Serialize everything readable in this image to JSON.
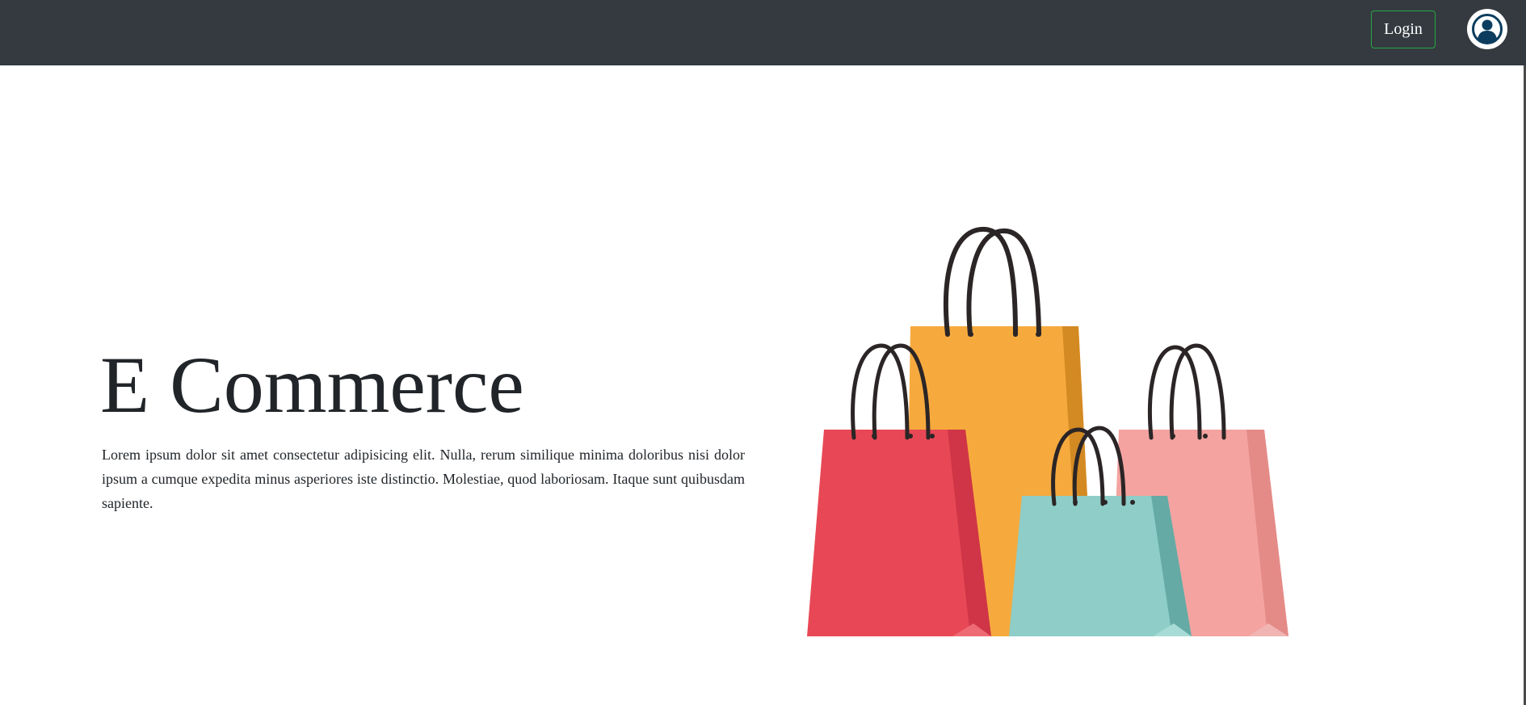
{
  "navbar": {
    "login_label": "Login",
    "avatar_icon": "user-avatar-icon",
    "background": "#343a40",
    "login_border": "#28a745"
  },
  "hero": {
    "title": "E Commerce",
    "description": "Lorem ipsum dolor sit amet consectetur adipisicing elit. Nulla, rerum similique minima doloribus nisi dolor ipsum a cumque expedita minus asperiores iste distinctio. Molestiae, quod laboriosam. Itaque sunt quibusdam sapiente.",
    "illustration": "shopping-bags-illustration"
  },
  "colors": {
    "bag_red": "#e84855",
    "bag_orange": "#f6aa3d",
    "bag_teal": "#8ecdc8",
    "bag_pink": "#f4a3a0",
    "handle": "#2b2526"
  }
}
